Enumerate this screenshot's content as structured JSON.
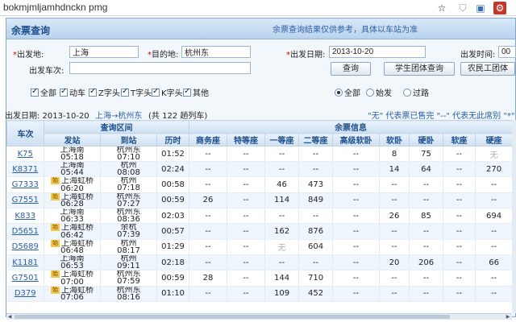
{
  "browser": {
    "address_text": "bokmjmljamhdnckn pmg",
    "icons": [
      "star-icon",
      "shield-icon",
      "extension-icon",
      "train-extension-icon"
    ]
  },
  "popup": {
    "title": "余票查询",
    "notice": "余票查询结果仅供参考，具体以车站为准"
  },
  "form": {
    "from_label": "出发地:",
    "from_value": "上海",
    "to_label": "目的地:",
    "to_value": "杭州东",
    "date_label": "出发日期:",
    "date_value": "2013-10-20",
    "time_label": "出发时间:",
    "time_value": "00",
    "train_label": "出发车次:",
    "train_value": "",
    "query_button": "查询",
    "student_button": "学生团体查询",
    "worker_button": "农民工团体",
    "filters": [
      {
        "label": "全部",
        "checked": true
      },
      {
        "label": "动车",
        "checked": true
      },
      {
        "label": "Z字头",
        "checked": true
      },
      {
        "label": "T字头",
        "checked": true
      },
      {
        "label": "K字头",
        "checked": true
      },
      {
        "label": "其他",
        "checked": true
      }
    ],
    "radios": [
      {
        "label": "全部",
        "on": true
      },
      {
        "label": "始发",
        "on": false
      },
      {
        "label": "过路",
        "on": false
      }
    ]
  },
  "summary": {
    "date_text": "出发日期: 2013-10-20",
    "route_text": "上海→杭州东",
    "count_text": "(共 122 趟列车)",
    "legend_text": "\"无\" 代表票已售完  \"--\" 代表无此席别  \"*\""
  },
  "table": {
    "group_headers": {
      "train": "车次",
      "range": "查询区间",
      "remain": "余票信息"
    },
    "columns": [
      "发站",
      "到站",
      "历时",
      "商务座",
      "特等座",
      "一等座",
      "二等座",
      "高级软卧",
      "软卧",
      "硬卧",
      "软座",
      "硬座"
    ],
    "rows": [
      {
        "train": "K75",
        "from_tag": false,
        "from": "上海南",
        "from_time": "05:18",
        "to": "杭州东",
        "to_time": "07:10",
        "dur": "01:52",
        "c": [
          "--",
          "--",
          "--",
          "--",
          "--",
          "8",
          "75",
          "--",
          "无"
        ]
      },
      {
        "train": "K8371",
        "from_tag": false,
        "from": "上海南",
        "from_time": "05:44",
        "to": "杭州",
        "to_time": "08:08",
        "dur": "02:24",
        "c": [
          "--",
          "--",
          "--",
          "--",
          "--",
          "14",
          "64",
          "--",
          "270"
        ]
      },
      {
        "train": "G7333",
        "from_tag": true,
        "from": "上海虹桥",
        "from_time": "06:20",
        "to": "杭州",
        "to_time": "07:18",
        "dur": "00:58",
        "c": [
          "--",
          "--",
          "46",
          "473",
          "--",
          "--",
          "--",
          "--",
          "--"
        ]
      },
      {
        "train": "G7551",
        "from_tag": true,
        "from": "上海虹桥",
        "from_time": "06:28",
        "to": "杭州东",
        "to_time": "07:27",
        "dur": "00:59",
        "c": [
          "26",
          "--",
          "114",
          "849",
          "--",
          "--",
          "--",
          "--",
          "--"
        ]
      },
      {
        "train": "K833",
        "from_tag": false,
        "from": "上海南",
        "from_time": "06:33",
        "to": "杭州东",
        "to_time": "08:36",
        "dur": "02:03",
        "c": [
          "--",
          "--",
          "--",
          "--",
          "--",
          "26",
          "85",
          "--",
          "694"
        ]
      },
      {
        "train": "D5651",
        "from_tag": true,
        "from": "上海虹桥",
        "from_time": "06:42",
        "to": "余杭",
        "to_time": "07:39",
        "dur": "00:57",
        "c": [
          "--",
          "--",
          "162",
          "876",
          "--",
          "--",
          "--",
          "--",
          "--"
        ]
      },
      {
        "train": "D5689",
        "from_tag": true,
        "from": "上海虹桥",
        "from_time": "06:48",
        "to": "杭州",
        "to_time": "08:17",
        "dur": "01:29",
        "c": [
          "--",
          "--",
          "无",
          "604",
          "--",
          "--",
          "--",
          "--",
          "--"
        ]
      },
      {
        "train": "K1181",
        "from_tag": false,
        "from": "上海南",
        "from_time": "06:53",
        "to": "杭州",
        "to_time": "09:11",
        "dur": "02:18",
        "c": [
          "--",
          "--",
          "--",
          "--",
          "--",
          "20",
          "206",
          "--",
          "66"
        ]
      },
      {
        "train": "G7501",
        "from_tag": true,
        "from": "上海虹桥",
        "from_time": "07:00",
        "to": "杭州东",
        "to_time": "07:59",
        "dur": "00:59",
        "c": [
          "28",
          "--",
          "144",
          "710",
          "--",
          "--",
          "--",
          "--",
          "--"
        ]
      },
      {
        "train": "D379",
        "from_tag": true,
        "from": "上海虹桥",
        "from_time": "07:06",
        "to": "杭州东",
        "to_time": "08:16",
        "dur": "01:10",
        "c": [
          "--",
          "--",
          "109",
          "452",
          "--",
          "--",
          "--",
          "--",
          "--"
        ]
      }
    ],
    "tag_label": "始"
  }
}
